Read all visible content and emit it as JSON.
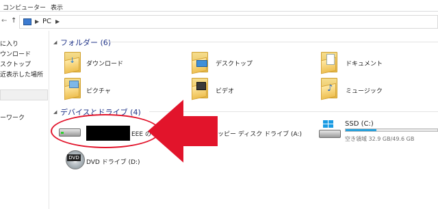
{
  "ribbon": {
    "tab_computer": "コンピューター",
    "tab_view": "表示"
  },
  "address": {
    "crumb": "PC"
  },
  "nav": {
    "items": [
      "に入り",
      "ウンロード",
      "スクトップ",
      "近表示した場所",
      "ーワーク"
    ]
  },
  "groups": {
    "folders_header": "フォルダー (6)",
    "devices_header": "デバイスとドライブ (4)"
  },
  "folders": [
    {
      "label": "ダウンロード",
      "icon": "download-folder-icon"
    },
    {
      "label": "デスクトップ",
      "icon": "desktop-folder-icon"
    },
    {
      "label": "ドキュメント",
      "icon": "documents-folder-icon"
    },
    {
      "label": "ピクチャ",
      "icon": "pictures-folder-icon"
    },
    {
      "label": "ビデオ",
      "icon": "videos-folder-icon"
    },
    {
      "label": "ミュージック",
      "icon": "music-folder-icon"
    }
  ],
  "drives": {
    "local_label_visible": "EEE の",
    "floppy_label": "ッピー ディスク ドライブ (A:)",
    "ssd_label": "SSD (C:)",
    "ssd_free": "空き領域 32.9 GB/49.6 GB",
    "ssd_used_fraction": 0.337,
    "dvd_label": "DVD ドライブ (D:)",
    "dvd_tag": "DVD"
  },
  "colors": {
    "header_blue": "#1e3287",
    "annotation_red": "#e2142b",
    "capacity_fill": "#26a0da"
  }
}
